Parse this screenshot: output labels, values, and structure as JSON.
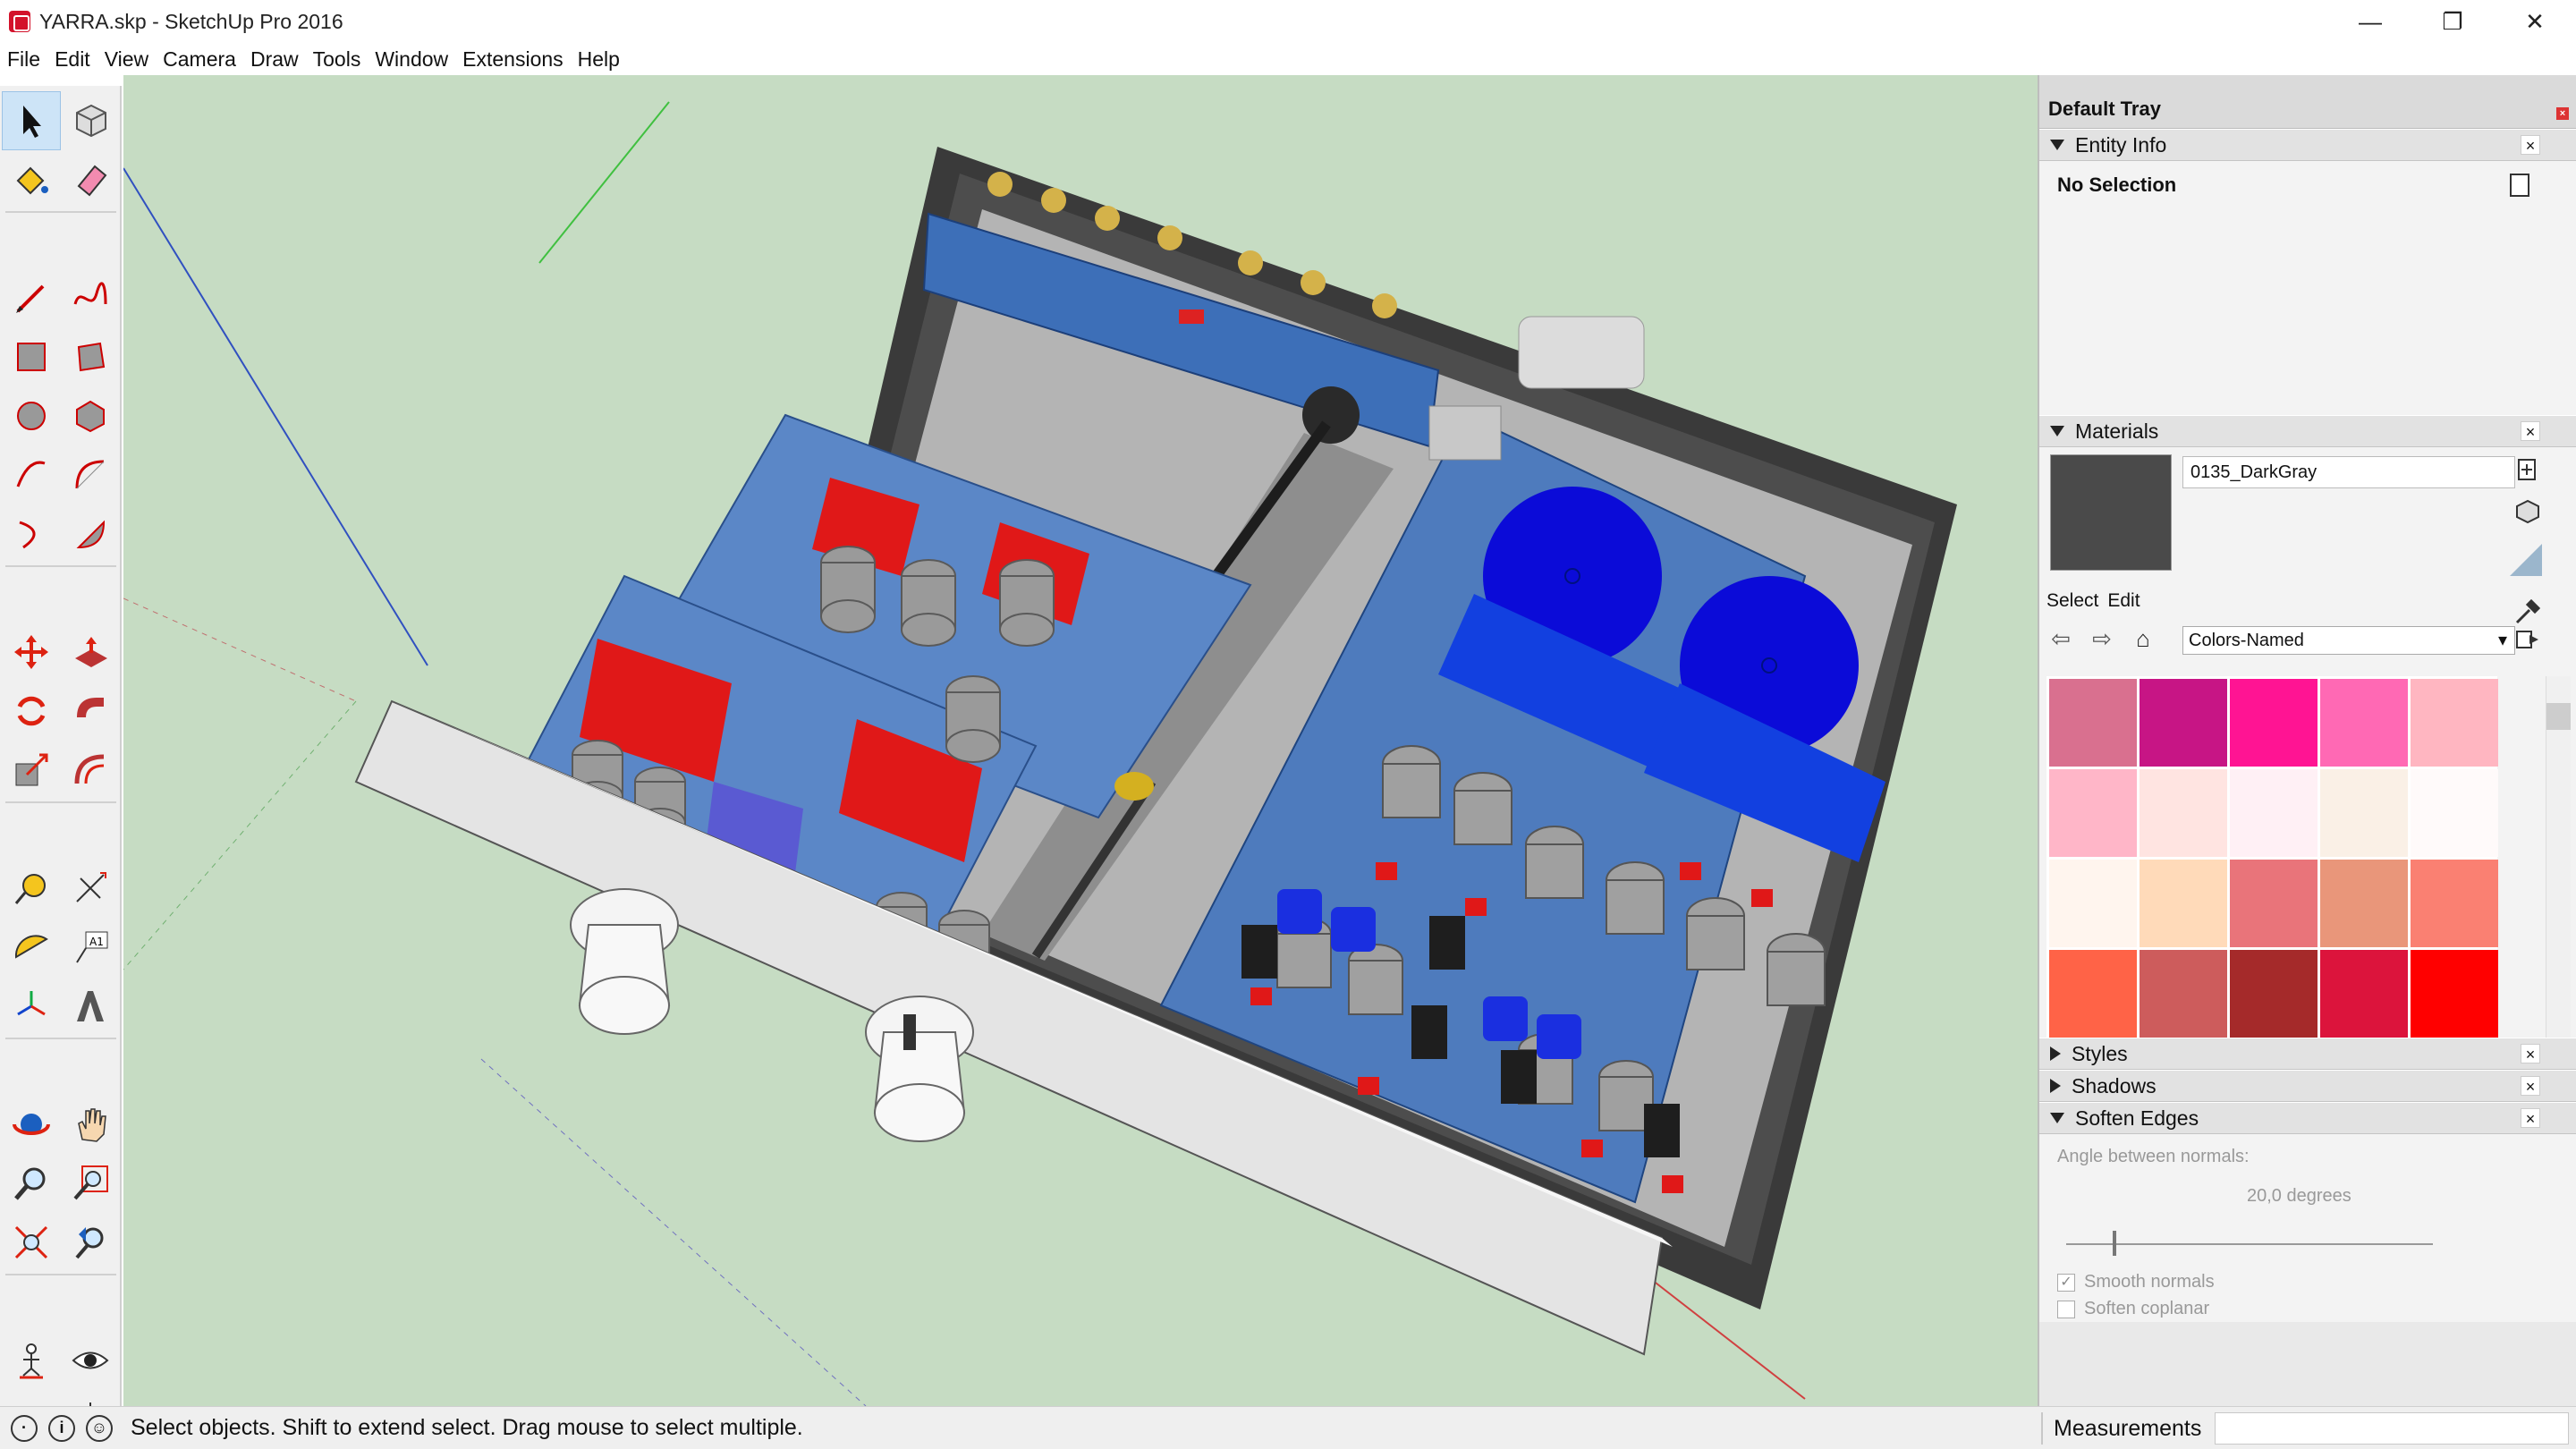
{
  "window": {
    "title": "YARRA.skp - SketchUp Pro 2016",
    "minimize": "—",
    "restore": "❐",
    "close": "✕"
  },
  "menu": [
    "File",
    "Edit",
    "View",
    "Camera",
    "Draw",
    "Tools",
    "Window",
    "Extensions",
    "Help"
  ],
  "tray": {
    "title": "Default Tray",
    "entity_info": {
      "label": "Entity Info",
      "selection": "No Selection"
    },
    "materials": {
      "label": "Materials",
      "current_name": "0135_DarkGray",
      "current_color": "#4a4a4a",
      "tab_select": "Select",
      "tab_edit": "Edit",
      "collection": "Colors-Named",
      "swatches": [
        "#d9708f",
        "#c71585",
        "#ff1493",
        "#ff69b4",
        "#ffb6c1",
        "#ffb6c8",
        "#ffe4e1",
        "#fff0f5",
        "#faf0e6",
        "#fffafa",
        "#fff5ee",
        "#ffdab9",
        "#e9747a",
        "#e9967a",
        "#fa8072",
        "#ff6347",
        "#cd5c5c",
        "#a52a2a",
        "#dc143c",
        "#ff0000"
      ]
    },
    "styles": {
      "label": "Styles"
    },
    "shadows": {
      "label": "Shadows"
    },
    "soften_edges": {
      "label": "Soften Edges",
      "angle_label": "Angle between normals:",
      "angle_value": "20,0  degrees",
      "smooth_normals": "Smooth normals",
      "soften_coplanar": "Soften coplanar"
    }
  },
  "status": {
    "message": "Select objects. Shift to extend select. Drag mouse to select multiple.",
    "measurements_label": "Measurements"
  }
}
